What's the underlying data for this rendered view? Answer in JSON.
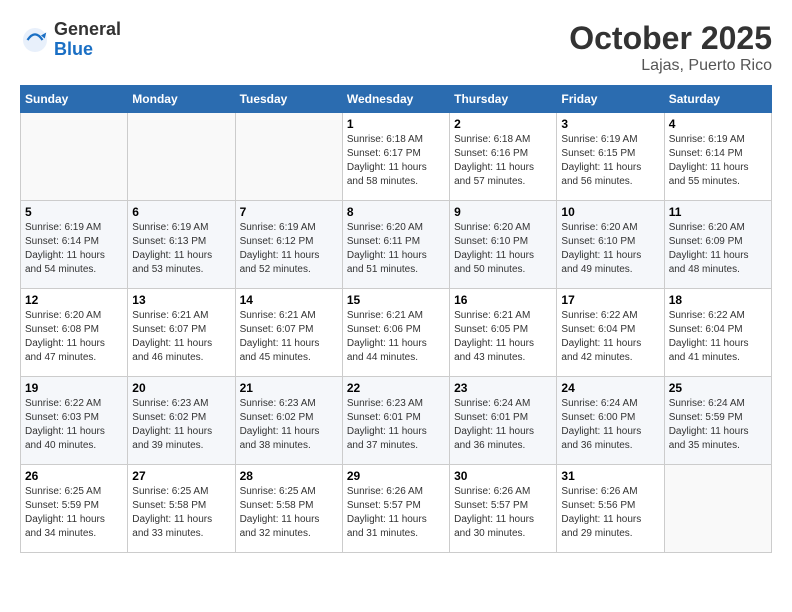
{
  "header": {
    "logo": {
      "general": "General",
      "blue": "Blue"
    },
    "month": "October 2025",
    "location": "Lajas, Puerto Rico"
  },
  "days_of_week": [
    "Sunday",
    "Monday",
    "Tuesday",
    "Wednesday",
    "Thursday",
    "Friday",
    "Saturday"
  ],
  "weeks": [
    [
      {
        "day": "",
        "info": ""
      },
      {
        "day": "",
        "info": ""
      },
      {
        "day": "",
        "info": ""
      },
      {
        "day": "1",
        "info": "Sunrise: 6:18 AM\nSunset: 6:17 PM\nDaylight: 11 hours\nand 58 minutes."
      },
      {
        "day": "2",
        "info": "Sunrise: 6:18 AM\nSunset: 6:16 PM\nDaylight: 11 hours\nand 57 minutes."
      },
      {
        "day": "3",
        "info": "Sunrise: 6:19 AM\nSunset: 6:15 PM\nDaylight: 11 hours\nand 56 minutes."
      },
      {
        "day": "4",
        "info": "Sunrise: 6:19 AM\nSunset: 6:14 PM\nDaylight: 11 hours\nand 55 minutes."
      }
    ],
    [
      {
        "day": "5",
        "info": "Sunrise: 6:19 AM\nSunset: 6:14 PM\nDaylight: 11 hours\nand 54 minutes."
      },
      {
        "day": "6",
        "info": "Sunrise: 6:19 AM\nSunset: 6:13 PM\nDaylight: 11 hours\nand 53 minutes."
      },
      {
        "day": "7",
        "info": "Sunrise: 6:19 AM\nSunset: 6:12 PM\nDaylight: 11 hours\nand 52 minutes."
      },
      {
        "day": "8",
        "info": "Sunrise: 6:20 AM\nSunset: 6:11 PM\nDaylight: 11 hours\nand 51 minutes."
      },
      {
        "day": "9",
        "info": "Sunrise: 6:20 AM\nSunset: 6:10 PM\nDaylight: 11 hours\nand 50 minutes."
      },
      {
        "day": "10",
        "info": "Sunrise: 6:20 AM\nSunset: 6:10 PM\nDaylight: 11 hours\nand 49 minutes."
      },
      {
        "day": "11",
        "info": "Sunrise: 6:20 AM\nSunset: 6:09 PM\nDaylight: 11 hours\nand 48 minutes."
      }
    ],
    [
      {
        "day": "12",
        "info": "Sunrise: 6:20 AM\nSunset: 6:08 PM\nDaylight: 11 hours\nand 47 minutes."
      },
      {
        "day": "13",
        "info": "Sunrise: 6:21 AM\nSunset: 6:07 PM\nDaylight: 11 hours\nand 46 minutes."
      },
      {
        "day": "14",
        "info": "Sunrise: 6:21 AM\nSunset: 6:07 PM\nDaylight: 11 hours\nand 45 minutes."
      },
      {
        "day": "15",
        "info": "Sunrise: 6:21 AM\nSunset: 6:06 PM\nDaylight: 11 hours\nand 44 minutes."
      },
      {
        "day": "16",
        "info": "Sunrise: 6:21 AM\nSunset: 6:05 PM\nDaylight: 11 hours\nand 43 minutes."
      },
      {
        "day": "17",
        "info": "Sunrise: 6:22 AM\nSunset: 6:04 PM\nDaylight: 11 hours\nand 42 minutes."
      },
      {
        "day": "18",
        "info": "Sunrise: 6:22 AM\nSunset: 6:04 PM\nDaylight: 11 hours\nand 41 minutes."
      }
    ],
    [
      {
        "day": "19",
        "info": "Sunrise: 6:22 AM\nSunset: 6:03 PM\nDaylight: 11 hours\nand 40 minutes."
      },
      {
        "day": "20",
        "info": "Sunrise: 6:23 AM\nSunset: 6:02 PM\nDaylight: 11 hours\nand 39 minutes."
      },
      {
        "day": "21",
        "info": "Sunrise: 6:23 AM\nSunset: 6:02 PM\nDaylight: 11 hours\nand 38 minutes."
      },
      {
        "day": "22",
        "info": "Sunrise: 6:23 AM\nSunset: 6:01 PM\nDaylight: 11 hours\nand 37 minutes."
      },
      {
        "day": "23",
        "info": "Sunrise: 6:24 AM\nSunset: 6:01 PM\nDaylight: 11 hours\nand 36 minutes."
      },
      {
        "day": "24",
        "info": "Sunrise: 6:24 AM\nSunset: 6:00 PM\nDaylight: 11 hours\nand 36 minutes."
      },
      {
        "day": "25",
        "info": "Sunrise: 6:24 AM\nSunset: 5:59 PM\nDaylight: 11 hours\nand 35 minutes."
      }
    ],
    [
      {
        "day": "26",
        "info": "Sunrise: 6:25 AM\nSunset: 5:59 PM\nDaylight: 11 hours\nand 34 minutes."
      },
      {
        "day": "27",
        "info": "Sunrise: 6:25 AM\nSunset: 5:58 PM\nDaylight: 11 hours\nand 33 minutes."
      },
      {
        "day": "28",
        "info": "Sunrise: 6:25 AM\nSunset: 5:58 PM\nDaylight: 11 hours\nand 32 minutes."
      },
      {
        "day": "29",
        "info": "Sunrise: 6:26 AM\nSunset: 5:57 PM\nDaylight: 11 hours\nand 31 minutes."
      },
      {
        "day": "30",
        "info": "Sunrise: 6:26 AM\nSunset: 5:57 PM\nDaylight: 11 hours\nand 30 minutes."
      },
      {
        "day": "31",
        "info": "Sunrise: 6:26 AM\nSunset: 5:56 PM\nDaylight: 11 hours\nand 29 minutes."
      },
      {
        "day": "",
        "info": ""
      }
    ]
  ]
}
